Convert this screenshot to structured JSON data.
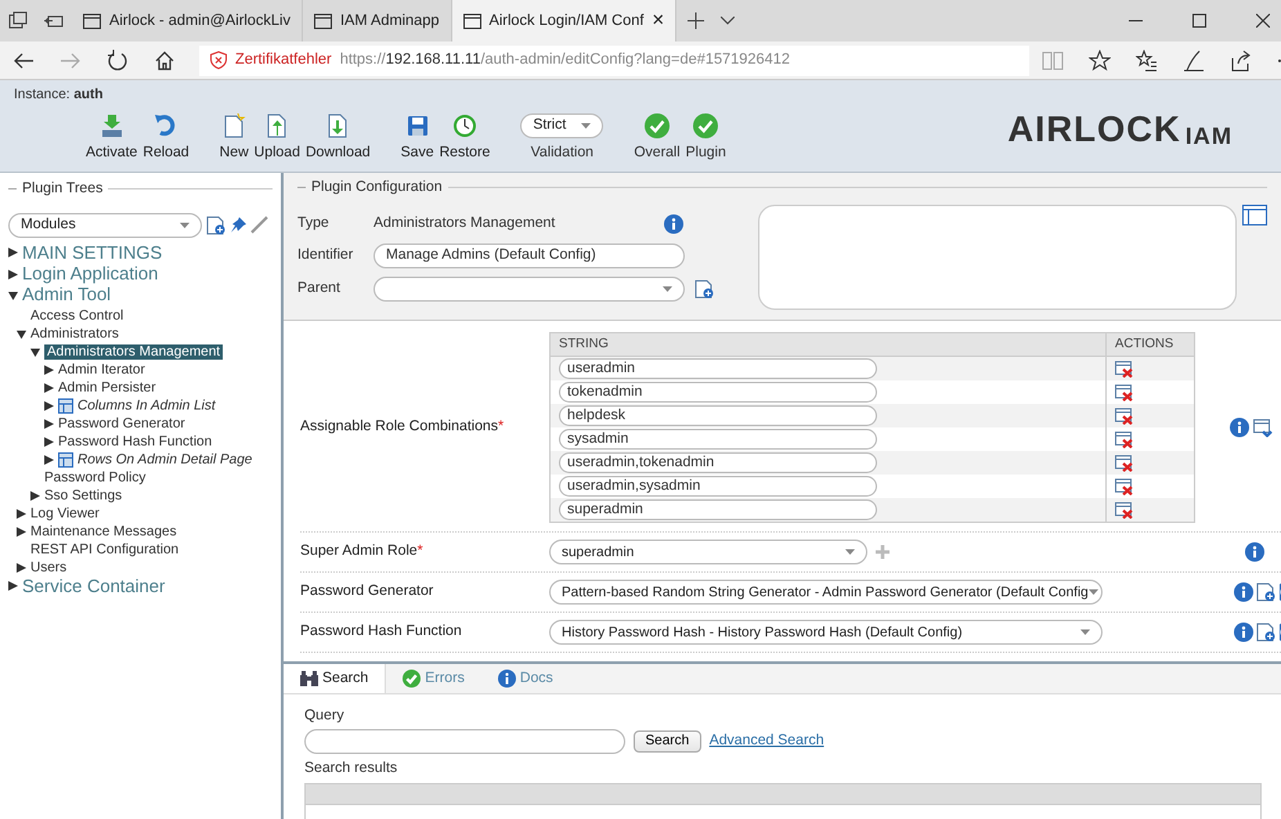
{
  "browser": {
    "tabs": [
      {
        "title": "Airlock - admin@AirlockLiv",
        "selected": false
      },
      {
        "title": "IAM Adminapp",
        "selected": false
      },
      {
        "title": "Airlock Login/IAM Conf",
        "selected": true,
        "close_glyph": "×"
      }
    ],
    "address": {
      "warning": "Zertifikatfehler",
      "scheme": "https://",
      "host": "192.168.11.11",
      "path": "/auth-admin/editConfig?lang=de#1571926412"
    }
  },
  "header": {
    "instance_label": "Instance:",
    "instance": "auth",
    "toolbar_groups": [
      [
        {
          "kind": "button",
          "label": "Activate"
        },
        {
          "kind": "button",
          "label": "Reload"
        }
      ],
      [
        {
          "kind": "button",
          "label": "New"
        },
        {
          "kind": "button",
          "label": "Upload"
        },
        {
          "kind": "button",
          "label": "Download"
        }
      ],
      [
        {
          "kind": "button",
          "label": "Save"
        },
        {
          "kind": "button",
          "label": "Restore"
        }
      ],
      [
        {
          "kind": "select",
          "value": "Strict",
          "label": "Validation"
        }
      ],
      [
        {
          "kind": "status",
          "ok": true,
          "label": "Overall"
        },
        {
          "kind": "status",
          "ok": true,
          "label": "Plugin"
        }
      ]
    ],
    "logo": {
      "main": "AIRLOCK",
      "suffix": "IAM"
    }
  },
  "sidebar": {
    "title": "Plugin Trees",
    "selector": "Modules",
    "tree": [
      {
        "label": "MAIN SETTINGS",
        "expanded": false
      },
      {
        "label": "Login Application",
        "expanded": false
      },
      {
        "label": "Admin Tool",
        "expanded": true,
        "children": [
          {
            "label": "Access Control"
          },
          {
            "label": "Administrators",
            "expanded": true,
            "children": [
              {
                "label": "Administrators Management",
                "expanded": true,
                "selected": true,
                "children": [
                  {
                    "label": "Admin Iterator",
                    "expanded": false
                  },
                  {
                    "label": "Admin Persister",
                    "expanded": false
                  },
                  {
                    "label": "Columns In Admin List",
                    "expanded": false,
                    "kind": "list"
                  },
                  {
                    "label": "Password Generator",
                    "expanded": false
                  },
                  {
                    "label": "Password Hash Function",
                    "expanded": false
                  },
                  {
                    "label": "Rows On Admin Detail Page",
                    "expanded": false,
                    "kind": "list"
                  }
                ]
              },
              {
                "label": "Password Policy"
              },
              {
                "label": "Sso Settings",
                "expanded": false
              }
            ]
          },
          {
            "label": "Log Viewer",
            "expanded": false
          },
          {
            "label": "Maintenance Messages",
            "expanded": false
          },
          {
            "label": "REST API Configuration"
          },
          {
            "label": "Users",
            "expanded": false
          }
        ]
      },
      {
        "label": "Service Container",
        "expanded": false
      }
    ]
  },
  "config": {
    "title": "Plugin Configuration",
    "type_label": "Type",
    "type": "Administrators Management",
    "identifier_label": "Identifier",
    "identifier": "Manage Admins (Default Config)",
    "parent_label": "Parent"
  },
  "properties": [
    {
      "kind": "table",
      "label": "Assignable Role Combinations",
      "required_mark": "*",
      "columns": [
        "STRING",
        "ACTIONS"
      ],
      "rows": [
        "useradmin",
        "tokenadmin",
        "helpdesk",
        "sysadmin",
        "useradmin,tokenadmin",
        "useradmin,sysadmin",
        "superadmin"
      ]
    },
    {
      "kind": "select",
      "label": "Super Admin Role",
      "required_mark": "*",
      "value": "superadmin",
      "plus": true
    },
    {
      "kind": "select",
      "label": "Password Generator",
      "value": "Pattern-based Random String Generator - Admin Password Generator (Default Config",
      "add": true
    },
    {
      "kind": "select",
      "label": "Password Hash Function",
      "value": "History Password Hash - History Password Hash (Default Config)",
      "add": true
    }
  ],
  "bottom": {
    "tabs": [
      {
        "label": "Search",
        "selected": true
      },
      {
        "label": "Errors",
        "selected": false
      },
      {
        "label": "Docs",
        "selected": false
      }
    ],
    "query_label": "Query",
    "search_button": "Search",
    "advanced_link": "Advanced Search",
    "results_label": "Search results"
  }
}
